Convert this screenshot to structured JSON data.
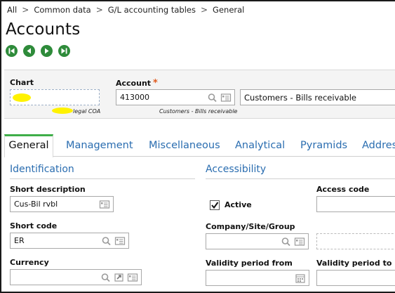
{
  "breadcrumb": {
    "items": [
      "All",
      "Common data",
      "G/L accounting tables",
      "General"
    ],
    "separator": ">"
  },
  "page": {
    "title": "Accounts"
  },
  "nav_buttons": [
    "first-record-icon",
    "previous-record-icon",
    "next-record-icon",
    "last-record-icon"
  ],
  "header": {
    "chart": {
      "label": "Chart",
      "value": "",
      "caption": "legal COA"
    },
    "account": {
      "label": "Account",
      "required_marker": "*",
      "value": "413000",
      "caption": "Customers - Bills receivable",
      "description": "Customers - Bills receivable"
    }
  },
  "tabs": [
    "General",
    "Management",
    "Miscellaneous",
    "Analytical",
    "Pyramids",
    "Addres"
  ],
  "active_tab": "General",
  "identification": {
    "title": "Identification",
    "short_description": {
      "label": "Short description",
      "value": "Cus-Bil rvbl"
    },
    "short_code": {
      "label": "Short code",
      "value": "ER"
    },
    "currency": {
      "label": "Currency",
      "value": ""
    }
  },
  "accessibility": {
    "title": "Accessibility",
    "active": {
      "label": "Active",
      "checked": true
    },
    "access_code": {
      "label": "Access code",
      "value": ""
    },
    "company_site_group": {
      "label": "Company/Site/Group",
      "value": ""
    },
    "validity_from": {
      "label": "Validity period from",
      "value": ""
    },
    "validity_to": {
      "label": "Validity period to",
      "value": ""
    }
  },
  "colors": {
    "accent_green": "#2e8b3a",
    "tab_active_border": "#3fae49",
    "link_blue": "#2a6db0",
    "required_orange": "#e05a1e",
    "highlight_yellow": "#fff200"
  }
}
